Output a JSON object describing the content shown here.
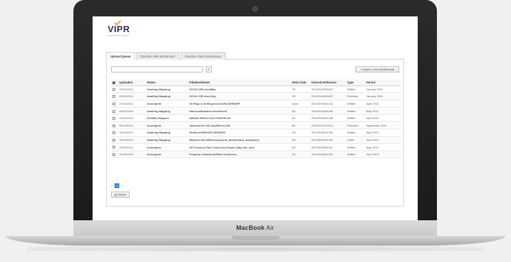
{
  "device": {
    "brand_bold": "MacBook",
    "brand_light": "Air"
  },
  "app": {
    "logo": "VIPR",
    "logo_tagline": "MANAGING RISKS",
    "tabs": [
      {
        "label": "Upload Queue",
        "active": true
      },
      {
        "label": "Overdue Risk Bordereaux",
        "active": false
      },
      {
        "label": "Overdue Claim Bordereaux",
        "active": false
      }
    ],
    "search": {
      "placeholder": "",
      "button_icon": "search-icon"
    },
    "import_button": "+ Import a new bordereaux",
    "table": {
      "headers": [
        "",
        "Uploaded",
        "Status",
        "File/Worksheet",
        "Risk Code",
        "Internal Reference",
        "Type",
        "Period"
      ],
      "rows": [
        {
          "uploaded": "29/01/2014",
          "status": "Awaiting Mapping",
          "file": "SCOA CSE.xlsx/May",
          "risk": "2E",
          "ref": "2014212420A167",
          "type": "Written",
          "period": "January 2014"
        },
        {
          "uploaded": "29/01/2014",
          "status": "Awaiting Mapping",
          "file": "SCOA CSE.xlsx/July",
          "risk": "2E",
          "ref": "2014212420A167",
          "type": "Premium",
          "period": "January 2014"
        },
        {
          "uploaded": "27/01/2014",
          "status": "Incomplete",
          "file": "Oil Rigs & Drilling Inc.xlsx/NLDERSHIP",
          "risk": "Auto",
          "ref": "20122879814143",
          "type": "Written",
          "period": "April 2013"
        },
        {
          "uploaded": "24/01/2014",
          "status": "Awaiting Mapping",
          "file": "HarrisonBowden.xlsx/Sheet1",
          "risk": "B2",
          "ref": "20132916494245",
          "type": "Written",
          "period": "May 2013"
        },
        {
          "uploaded": "23/01/2014",
          "status": "Partially Mapped",
          "file": "Atlantic Marine.xls/LONDON Alt",
          "risk": "B1",
          "ref": "20132916614238",
          "type": "Written",
          "period": "April 2013"
        },
        {
          "uploaded": "06/12/2013",
          "status": "Incomplete",
          "file": "Jarksnohire US.xlsx/Bdx to UW",
          "risk": "B1",
          "ref": "20132912742214",
          "type": "Premium",
          "period": "September 2013"
        },
        {
          "uploaded": "18/10/2013",
          "status": "Awaiting Mapping",
          "file": "Realty.xls/BDHAR DEFINED",
          "risk": "DC",
          "ref": "20132916974239",
          "type": "Written",
          "period": "April 2013"
        },
        {
          "uploaded": "18/10/2013",
          "status": "Awaiting Mapping",
          "file": "Maintrix Std GBPstock(count_Bordereaux_Analysis1)",
          "risk": "B4",
          "ref": "20122862314150",
          "type": "Claim",
          "period": "June 2012"
        },
        {
          "uploaded": "20/09/2013",
          "status": "Incomplete",
          "file": "US Property East Coast.xlsx/Topics May and June",
          "risk": "B2",
          "ref": "20132916534241",
          "type": "Written",
          "period": "May 2013"
        },
        {
          "uploaded": "12/09/2013",
          "status": "Incomplete",
          "file": "Property Coastal.xls/Risk bordereau",
          "risk": "B2",
          "ref": "20132916614235",
          "type": "Written",
          "period": "June 2013"
        }
      ]
    },
    "pager": {
      "prev": "«",
      "current": "1",
      "next": "»"
    },
    "delete_button": "Delete"
  }
}
